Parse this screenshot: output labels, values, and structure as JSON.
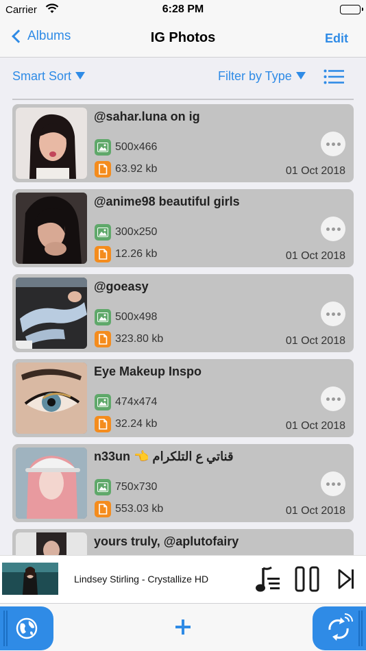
{
  "status": {
    "carrier": "Carrier",
    "time": "6:28 PM"
  },
  "nav": {
    "back_label": "Albums",
    "title": "IG Photos",
    "edit_label": "Edit"
  },
  "toolbar": {
    "smart_sort": "Smart Sort",
    "filter": "Filter by Type"
  },
  "items": [
    {
      "title": "@sahar.luna on ig",
      "dimensions": "500x466",
      "size": "63.92 kb",
      "date": "01 Oct 2018"
    },
    {
      "title": "@anime98  beautiful girls",
      "dimensions": "300x250",
      "size": "12.26 kb",
      "date": "01 Oct 2018"
    },
    {
      "title": "@goeasy",
      "dimensions": "500x498",
      "size": "323.80 kb",
      "date": "01 Oct 2018"
    },
    {
      "title": "Eye Makeup Inspo",
      "dimensions": "474x474",
      "size": "32.24 kb",
      "date": "01 Oct 2018"
    },
    {
      "title": "n33un 👈 قناتي ع التلكرام",
      "dimensions": "750x730",
      "size": "553.03 kb",
      "date": "01 Oct 2018"
    },
    {
      "title": "yours truly, @aplutofairy",
      "dimensions": "",
      "size": "",
      "date": ""
    }
  ],
  "player": {
    "track": "Lindsey Stirling - Crystallize HD"
  },
  "colors": {
    "accent": "#2f8be6",
    "card": "#c3c3c3",
    "image_badge": "#5fa86a",
    "file_badge": "#f48c1d"
  }
}
